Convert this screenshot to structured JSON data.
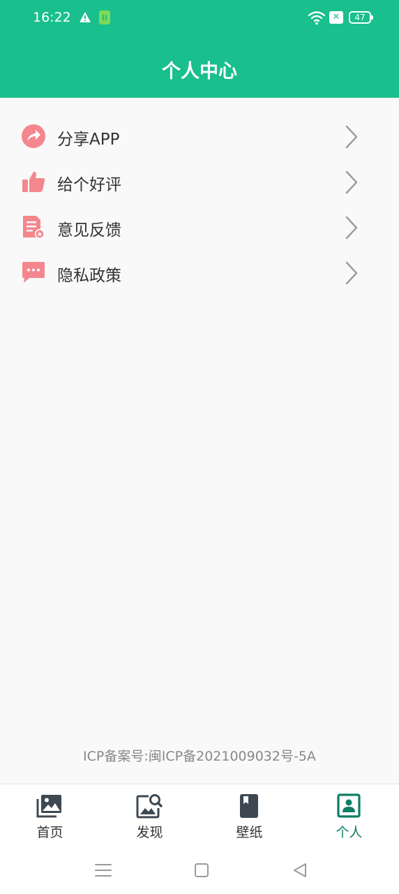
{
  "status_bar": {
    "time": "16:22",
    "battery": "47",
    "icons": [
      "warning-icon",
      "app-notification-icon",
      "wifi-icon",
      "sim-off-icon",
      "battery-icon"
    ]
  },
  "header": {
    "title": "个人中心"
  },
  "menu": {
    "items": [
      {
        "label": "分享APP",
        "icon": "share-icon"
      },
      {
        "label": "给个好评",
        "icon": "thumbs-up-icon"
      },
      {
        "label": "意见反馈",
        "icon": "feedback-document-icon"
      },
      {
        "label": "隐私政策",
        "icon": "chat-bubble-icon"
      }
    ],
    "icon_color": "#f4878d",
    "chevron_color": "#9a9a9a"
  },
  "footer": {
    "icp": "ICP备案号:闽ICP备2021009032号-5A"
  },
  "tabbar": {
    "tabs": [
      {
        "label": "首页",
        "icon": "gallery-icon"
      },
      {
        "label": "发现",
        "icon": "image-search-icon"
      },
      {
        "label": "壁纸",
        "icon": "bookmark-book-icon"
      },
      {
        "label": "个人",
        "icon": "contact-card-icon"
      }
    ],
    "active_index": 3,
    "active_color": "#0e7d63",
    "inactive_color": "#3d4852"
  },
  "theme": {
    "primary": "#19bf8c",
    "background": "#f9f9f9"
  }
}
